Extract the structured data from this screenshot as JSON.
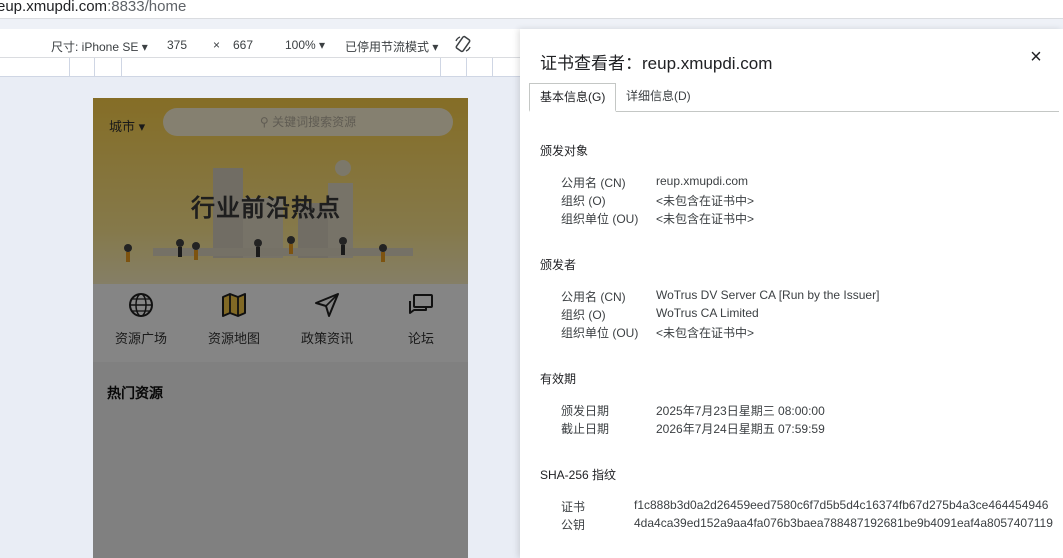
{
  "browser": {
    "url_host": "eup.xmupdi.com",
    "url_rest": ":8833/home"
  },
  "devtools": {
    "device": "尺寸: iPhone SE ▾",
    "width": "375",
    "times": "×",
    "height": "667",
    "zoom": "100% ▾",
    "throttle": "已停用节流模式 ▾"
  },
  "phone": {
    "city": "城市 ▾",
    "search_placeholder": "关键词搜索资源",
    "banner_headline": "行业前沿热点",
    "nav": [
      {
        "label": "资源广场",
        "icon": "globe-icon"
      },
      {
        "label": "资源地图",
        "icon": "map-icon"
      },
      {
        "label": "政策资讯",
        "icon": "send-icon"
      },
      {
        "label": "论坛",
        "icon": "chat-icon"
      }
    ],
    "hot_title": "热门资源"
  },
  "cert": {
    "title": "证书查看者：reup.xmupdi.com",
    "close": "×",
    "tabs": [
      "基本信息(G)",
      "详细信息(D)"
    ],
    "subject": {
      "heading": "颁发对象",
      "rows": [
        {
          "k": "公用名 (CN)",
          "v": "reup.xmupdi.com"
        },
        {
          "k": "组织 (O)",
          "v": "<未包含在证书中>"
        },
        {
          "k": "组织单位 (OU)",
          "v": "<未包含在证书中>"
        }
      ]
    },
    "issuer": {
      "heading": "颁发者",
      "rows": [
        {
          "k": "公用名 (CN)",
          "v": "WoTrus DV Server CA  [Run by the Issuer]"
        },
        {
          "k": "组织 (O)",
          "v": "WoTrus CA Limited"
        },
        {
          "k": "组织单位 (OU)",
          "v": "<未包含在证书中>"
        }
      ]
    },
    "validity": {
      "heading": "有效期",
      "rows": [
        {
          "k": "颁发日期",
          "v": "2025年7月23日星期三 08:00:00"
        },
        {
          "k": "截止日期",
          "v": "2026年7月24日星期五 07:59:59"
        }
      ]
    },
    "fingerprint": {
      "heading": "SHA-256 指纹",
      "rows": [
        {
          "k": "证书",
          "v": "f1c888b3d0a2d26459eed7580c6f7d5b5d4c16374fb67d275b4a3ce464454946"
        },
        {
          "k": "公钥",
          "v": "4da4ca39ed152a9aa4fa076b3baea788487192681be9b4091eaf4a8057407119"
        }
      ]
    }
  }
}
